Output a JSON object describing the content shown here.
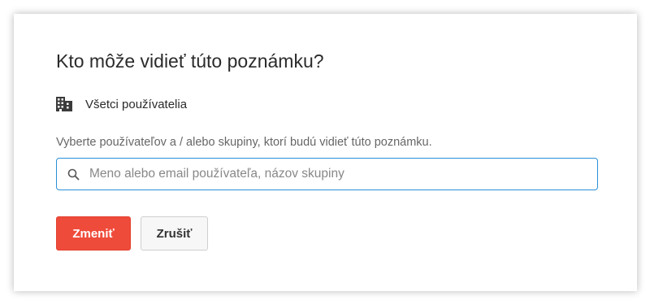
{
  "dialog": {
    "title": "Kto môže vidieť túto poznámku?",
    "visibility": {
      "icon": "building-icon",
      "label": "Všetci používatelia"
    },
    "help_text": "Vyberte používateľov a / alebo skupiny, ktorí budú vidieť túto poznámku.",
    "search": {
      "icon": "search-icon",
      "value": "",
      "placeholder": "Meno alebo email používateľa, názov skupiny"
    },
    "buttons": {
      "confirm_label": "Zmeniť",
      "cancel_label": "Zrušiť"
    },
    "colors": {
      "primary": "#ef4b3b",
      "focus_border": "#2a8fd8"
    }
  }
}
